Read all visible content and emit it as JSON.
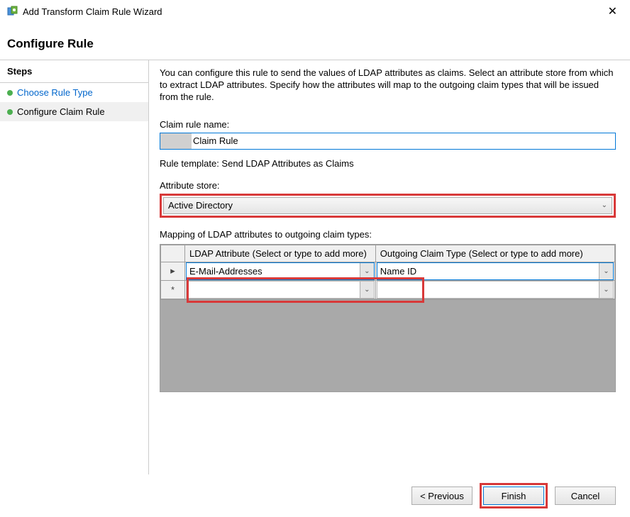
{
  "window": {
    "title": "Add Transform Claim Rule Wizard"
  },
  "heading": "Configure Rule",
  "sidebar": {
    "header": "Steps",
    "items": [
      {
        "label": "Choose Rule Type"
      },
      {
        "label": "Configure Claim Rule"
      }
    ]
  },
  "main": {
    "description": "You can configure this rule to send the values of LDAP attributes as claims. Select an attribute store from which to extract LDAP attributes. Specify how the attributes will map to the outgoing claim types that will be issued from the rule.",
    "claim_rule_name_label": "Claim rule name:",
    "claim_rule_name_value": "Claim Rule",
    "rule_template_line": "Rule template: Send LDAP Attributes as Claims",
    "attribute_store_label": "Attribute store:",
    "attribute_store_value": "Active Directory",
    "mapping_label": "Mapping of LDAP attributes to outgoing claim types:",
    "table": {
      "col1_header": "LDAP Attribute (Select or type to add more)",
      "col2_header": "Outgoing Claim Type (Select or type to add more)",
      "rows": [
        {
          "marker": "▸",
          "ldap": "E-Mail-Addresses",
          "claim": "Name ID"
        },
        {
          "marker": "*",
          "ldap": "",
          "claim": ""
        }
      ]
    }
  },
  "buttons": {
    "previous": "< Previous",
    "finish": "Finish",
    "cancel": "Cancel"
  }
}
